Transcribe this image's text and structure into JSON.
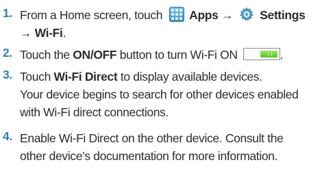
{
  "steps": [
    {
      "number": "1.",
      "prefix": "From a Home screen, touch",
      "apps": "Apps",
      "arrow1": "→",
      "settings": "Settings",
      "arrow2": "→",
      "wifi": "Wi-Fi",
      "end": ".",
      "icons": [
        "apps-grid-icon",
        "settings-gear-icon"
      ]
    },
    {
      "number": "2.",
      "prefix": "Touch the",
      "bold": "ON/OFF",
      "suffix": "button to turn Wi-Fi ON",
      "end": ".",
      "icons": [
        "toggle-switch-icon"
      ],
      "toggle_state": "on",
      "toggle_color": "#5cc523"
    },
    {
      "number": "3.",
      "prefix": "Touch",
      "bold": "Wi-Fi Direct",
      "suffix": "to display available devices.",
      "note_line1": "Your device begins to search for other devices enabled",
      "note_line2": "with Wi-Fi direct connections."
    },
    {
      "number": "4.",
      "line1": "Enable Wi-Fi Direct on the other device. Consult the",
      "line2": "other device’s documentation for more information."
    }
  ],
  "colors": {
    "step_number": "#2b7fc0",
    "text": "#2b2b2b"
  }
}
